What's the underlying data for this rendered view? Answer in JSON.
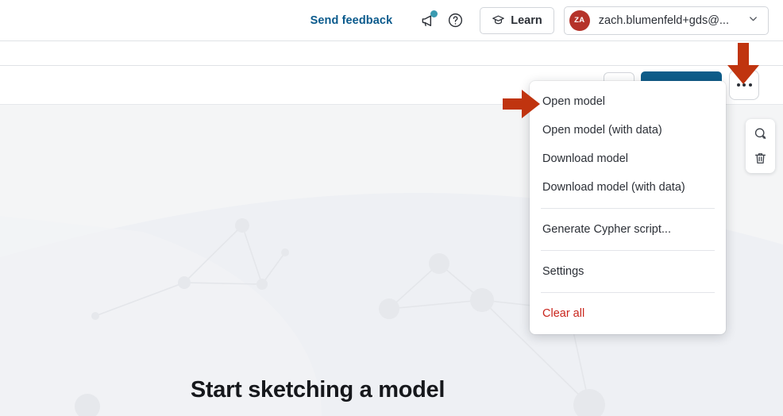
{
  "topbar": {
    "send_feedback_label": "Send feedback",
    "send_feedback_color": "#0a5a8c",
    "megaphone_icon": "megaphone-icon",
    "notification_dot_color": "#3a9ab0",
    "help_icon": "help-circle-icon",
    "learn_label": "Learn",
    "learn_icon": "graduation-cap-icon",
    "account": {
      "avatar_initials": "ZA",
      "avatar_color": "#b5332a",
      "name": "zach.blumenfeld+gds@...",
      "chevron_icon": "chevron-down-icon"
    }
  },
  "toolbar": {
    "more_button_label": "...",
    "more_button_icon": "ellipsis-icon",
    "primary_button_color": "#0e5d8a"
  },
  "menu": {
    "items": [
      {
        "label": "Open model",
        "type": "item"
      },
      {
        "label": "Open model (with data)",
        "type": "item"
      },
      {
        "label": "Download model",
        "type": "item"
      },
      {
        "label": "Download model (with data)",
        "type": "item"
      },
      {
        "label": "Generate Cypher script...",
        "type": "item"
      },
      {
        "label": "Settings",
        "type": "item"
      },
      {
        "label": "Clear all",
        "type": "danger"
      }
    ],
    "danger_color": "#c9251c"
  },
  "side_panel": {
    "zoom_in_icon": "zoom-in-icon",
    "delete_icon": "trash-icon"
  },
  "canvas": {
    "title": "Start sketching a model",
    "background_color": "#f4f5f6",
    "wave_color": "#eef0f4",
    "node_color": "#e6e8ec"
  },
  "annotations": {
    "arrow_color": "#c0340f",
    "down_arrow": "arrow-down-annotation",
    "right_arrow": "arrow-right-annotation"
  }
}
